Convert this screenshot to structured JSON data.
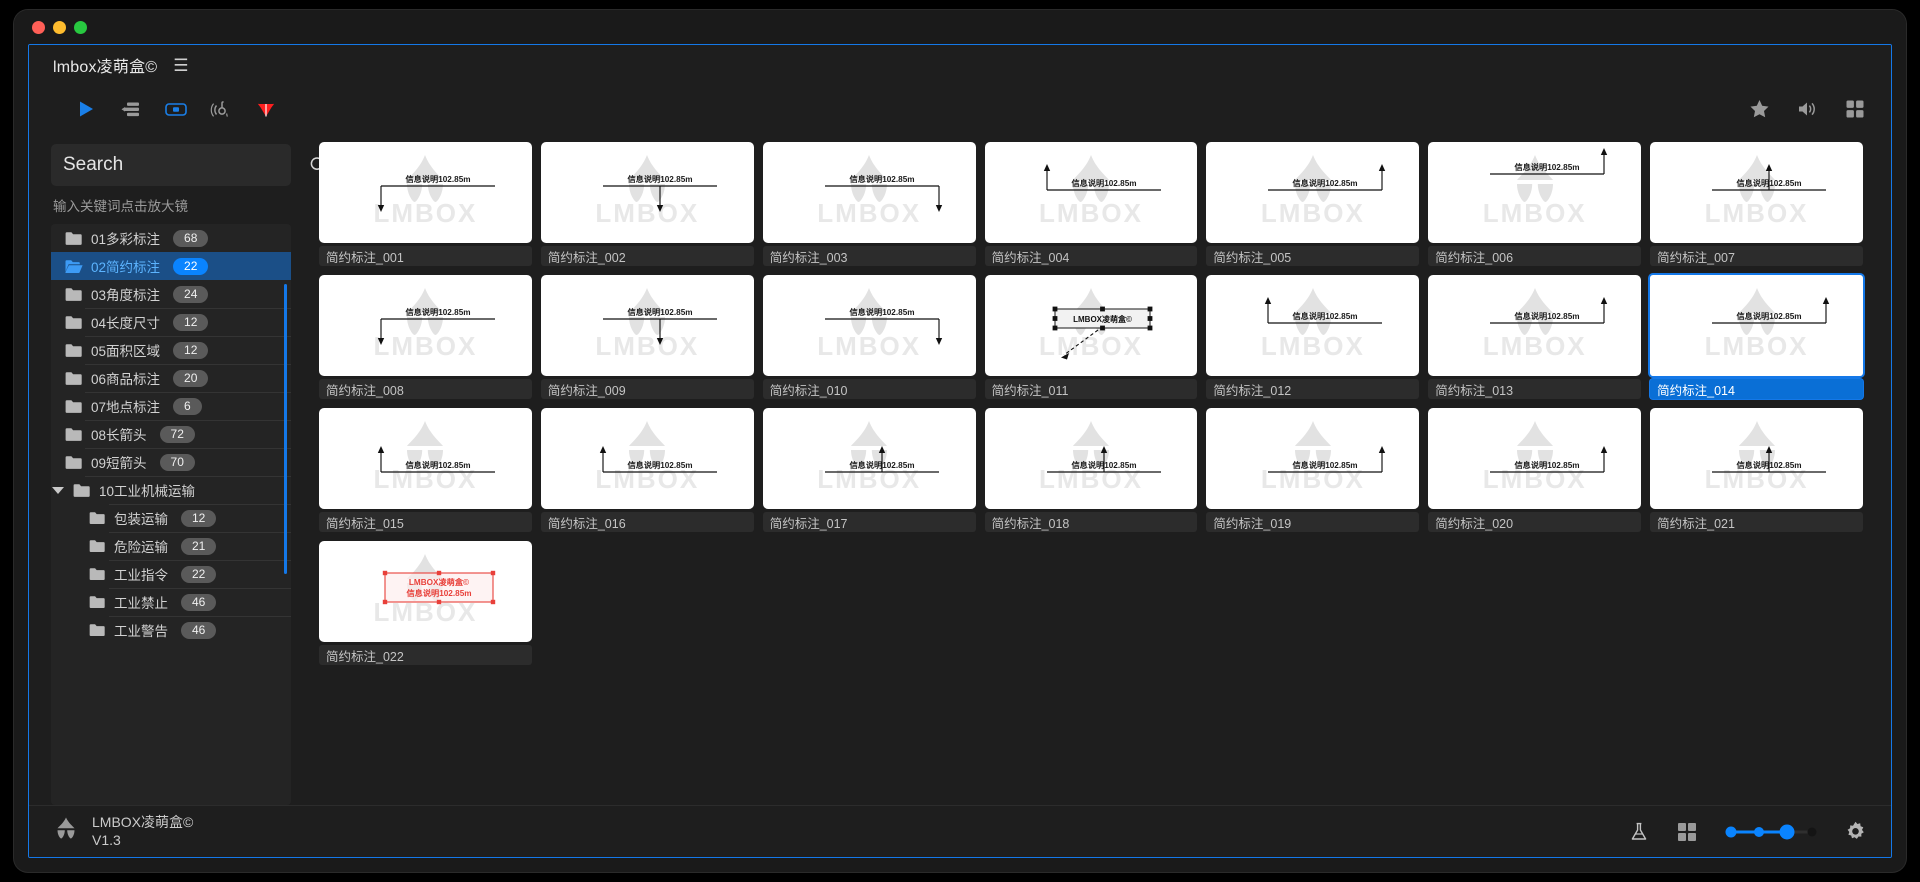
{
  "window": {
    "traffic_lights": [
      "close",
      "minimize",
      "maximize"
    ]
  },
  "header": {
    "title": "lmbox凌萌盒©",
    "menu_icon": "hamburger-icon"
  },
  "toolbar": {
    "left_icons": [
      {
        "name": "play-icon",
        "color": "#1a7fe8"
      },
      {
        "name": "list-align-icon",
        "color": "#9a9a9a"
      },
      {
        "name": "frame-icon",
        "color": "#1a7fe8"
      },
      {
        "name": "signal-icon",
        "color": "#9a9a9a"
      },
      {
        "name": "diamond-icon",
        "color": "#ff1f1f"
      }
    ],
    "right_icons": [
      {
        "name": "star-icon",
        "color": "#9a9a9a"
      },
      {
        "name": "speaker-icon",
        "color": "#9a9a9a"
      },
      {
        "name": "grid-icon",
        "color": "#9a9a9a"
      }
    ]
  },
  "search": {
    "value": "",
    "placeholder": "Search",
    "hint": "输入关键词点击放大镜",
    "icon": "search-icon"
  },
  "sidebar": {
    "folders": [
      {
        "label": "01多彩标注",
        "count": "68",
        "selected": false,
        "sub": false,
        "caret": false
      },
      {
        "label": "02简约标注",
        "count": "22",
        "selected": true,
        "sub": false,
        "caret": false
      },
      {
        "label": "03角度标注",
        "count": "24",
        "selected": false,
        "sub": false,
        "caret": false
      },
      {
        "label": "04长度尺寸",
        "count": "12",
        "selected": false,
        "sub": false,
        "caret": false
      },
      {
        "label": "05面积区域",
        "count": "12",
        "selected": false,
        "sub": false,
        "caret": false
      },
      {
        "label": "06商品标注",
        "count": "20",
        "selected": false,
        "sub": false,
        "caret": false
      },
      {
        "label": "07地点标注",
        "count": "6",
        "selected": false,
        "sub": false,
        "caret": false
      },
      {
        "label": "08长箭头",
        "count": "72",
        "selected": false,
        "sub": false,
        "caret": false
      },
      {
        "label": "09短箭头",
        "count": "70",
        "selected": false,
        "sub": false,
        "caret": false
      },
      {
        "label": "10工业机械运输",
        "count": "",
        "selected": false,
        "sub": false,
        "caret": true
      },
      {
        "label": "包装运输",
        "count": "12",
        "selected": false,
        "sub": true,
        "caret": false
      },
      {
        "label": "危险运输",
        "count": "21",
        "selected": false,
        "sub": true,
        "caret": false
      },
      {
        "label": "工业指令",
        "count": "22",
        "selected": false,
        "sub": true,
        "caret": false
      },
      {
        "label": "工业禁止",
        "count": "46",
        "selected": false,
        "sub": true,
        "caret": false
      },
      {
        "label": "工业警告",
        "count": "46",
        "selected": false,
        "sub": true,
        "caret": false
      }
    ]
  },
  "grid": {
    "watermark_text": "LMBOX",
    "annotation_text": "信息说明102.85m",
    "callout_text": "LMBOX凌萌盒©",
    "items": [
      {
        "label": "简约标注_001",
        "variant": "left",
        "selected": false
      },
      {
        "label": "简约标注_002",
        "variant": "center",
        "selected": false
      },
      {
        "label": "简约标注_003",
        "variant": "right",
        "selected": false
      },
      {
        "label": "简约标注_004",
        "variant": "leftup",
        "selected": false
      },
      {
        "label": "简约标注_005",
        "variant": "rightup",
        "selected": false
      },
      {
        "label": "简约标注_006",
        "variant": "rightup2",
        "selected": false
      },
      {
        "label": "简约标注_007",
        "variant": "centerup",
        "selected": false
      },
      {
        "label": "简约标注_008",
        "variant": "left",
        "selected": false
      },
      {
        "label": "简约标注_009",
        "variant": "center",
        "selected": false
      },
      {
        "label": "简约标注_010",
        "variant": "right",
        "selected": false
      },
      {
        "label": "简约标注_011",
        "variant": "callout",
        "selected": false
      },
      {
        "label": "简约标注_012",
        "variant": "leftup",
        "selected": false
      },
      {
        "label": "简约标注_013",
        "variant": "rightup",
        "selected": false
      },
      {
        "label": "简约标注_014",
        "variant": "rightup",
        "selected": true
      },
      {
        "label": "简约标注_015",
        "variant": "below-left",
        "selected": false
      },
      {
        "label": "简约标注_016",
        "variant": "below-left",
        "selected": false
      },
      {
        "label": "简约标注_017",
        "variant": "below-center",
        "selected": false
      },
      {
        "label": "简约标注_018",
        "variant": "below-center",
        "selected": false
      },
      {
        "label": "简约标注_019",
        "variant": "below-right",
        "selected": false
      },
      {
        "label": "简约标注_020",
        "variant": "below-right",
        "selected": false
      },
      {
        "label": "简约标注_021",
        "variant": "below-center",
        "selected": false
      },
      {
        "label": "简约标注_022",
        "variant": "redbox",
        "selected": false
      }
    ]
  },
  "footer": {
    "brand_name": "LMBOX凌萌盒©",
    "version": "V1.3",
    "logo_icon": "lmbox-logo-icon",
    "icons": [
      {
        "name": "flask-icon"
      },
      {
        "name": "grid-view-icon"
      },
      {
        "name": "settings-gear-icon"
      }
    ],
    "slider": {
      "steps": 4,
      "active_index": 2,
      "accent": "#0a84ff"
    }
  },
  "colors": {
    "accent": "#1478e8",
    "selection": "#0a84ff",
    "sidebar_selected_bg": "#1b4f87",
    "app_bg": "#1e1e1e",
    "card_bg": "#ffffff",
    "alert_red": "#ff1f1f"
  }
}
